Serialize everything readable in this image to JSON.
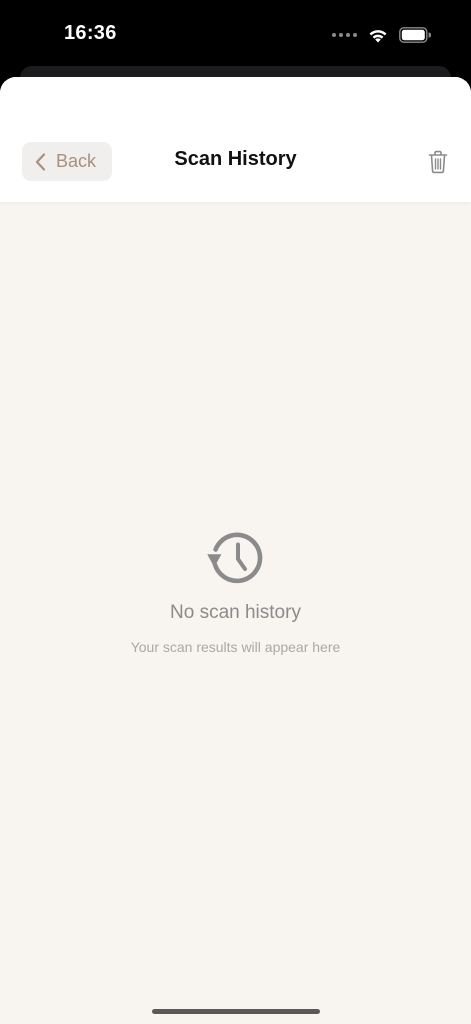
{
  "status_bar": {
    "time": "16:36"
  },
  "nav": {
    "back_label": "Back",
    "title": "Scan History"
  },
  "empty_state": {
    "title": "No scan history",
    "subtitle": "Your scan results will appear here"
  },
  "colors": {
    "accent": "#a8907c",
    "background": "#f8f4f0",
    "header": "#ffffff",
    "muted_text": "#8b8b8b"
  },
  "icons": {
    "back": "chevron-left-icon",
    "delete": "trash-icon",
    "empty": "history-icon"
  }
}
